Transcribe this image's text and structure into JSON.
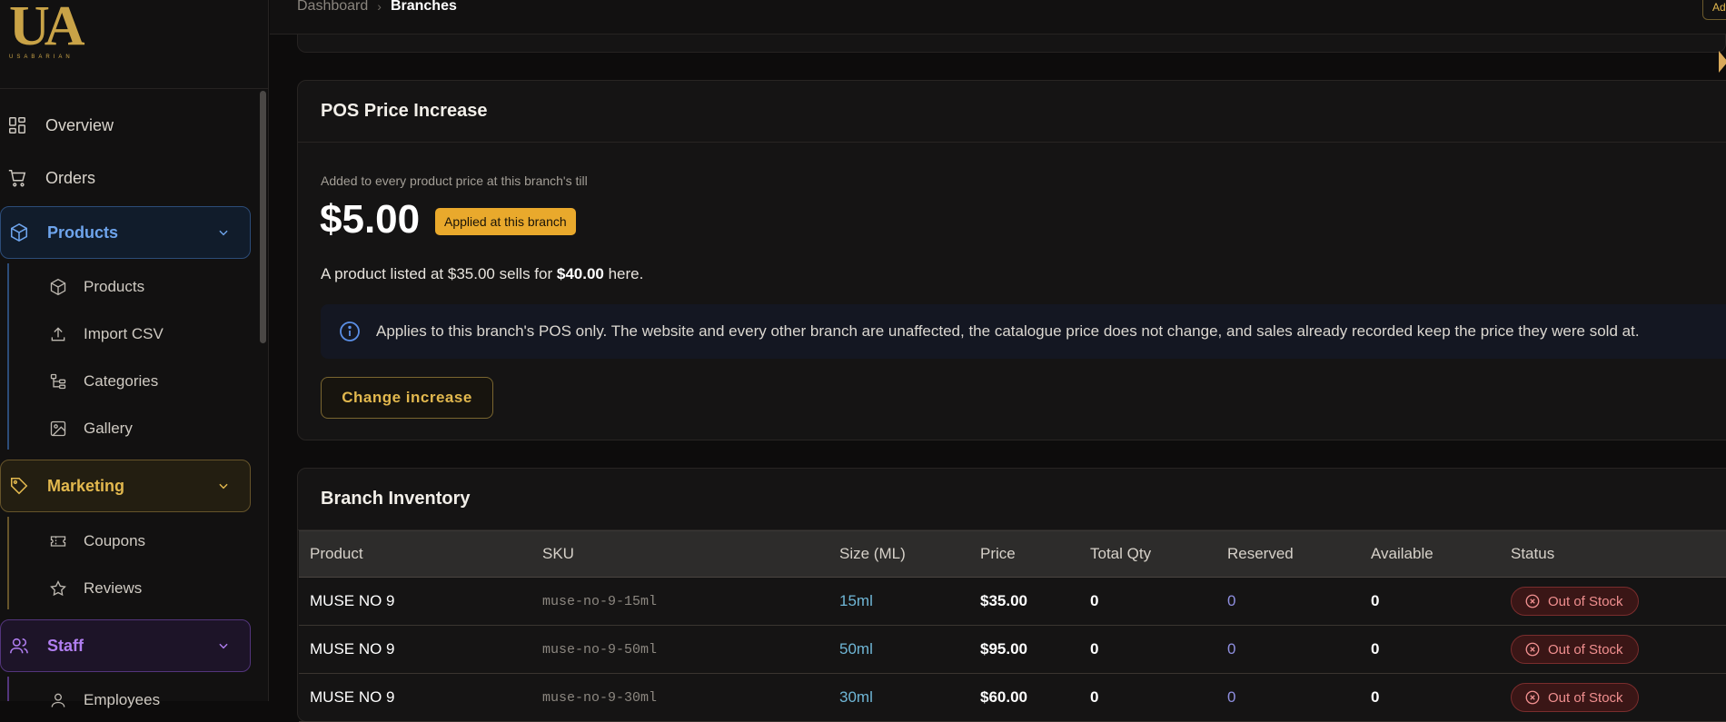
{
  "brand": {
    "mark": "UA",
    "name": "USABARIAN",
    "color": "#c9a347"
  },
  "breadcrumb": {
    "root": "Dashboard",
    "current": "Branches"
  },
  "topbar": {
    "action_label": "Ad"
  },
  "sidebar": {
    "items": [
      {
        "label": "Overview",
        "icon": "grid-icon"
      },
      {
        "label": "Orders",
        "icon": "cart-icon"
      }
    ],
    "groups": {
      "products": {
        "label": "Products",
        "icon": "box-icon",
        "color": "#6ea4ec",
        "children": [
          {
            "label": "Products",
            "icon": "box-icon"
          },
          {
            "label": "Import CSV",
            "icon": "upload-icon"
          },
          {
            "label": "Categories",
            "icon": "tree-icon"
          },
          {
            "label": "Gallery",
            "icon": "image-icon"
          }
        ]
      },
      "marketing": {
        "label": "Marketing",
        "icon": "tag-icon",
        "color": "#e2b84e",
        "children": [
          {
            "label": "Coupons",
            "icon": "ticket-icon"
          },
          {
            "label": "Reviews",
            "icon": "star-icon"
          }
        ]
      },
      "staff": {
        "label": "Staff",
        "icon": "users-icon",
        "color": "#b07ef0",
        "children": [
          {
            "label": "Employees",
            "icon": "user-icon"
          }
        ]
      }
    }
  },
  "pos": {
    "title": "POS Price Increase",
    "subtitle": "Added to every product price at this branch's till",
    "amount": "$5.00",
    "badge": "Applied at this branch",
    "note_prefix": "A product listed at $35.00 sells for ",
    "note_price": "$40.00",
    "note_suffix": " here.",
    "info": "Applies to this branch's POS only. The website and every other branch are unaffected, the catalogue price does not change, and sales already recorded keep the price they were sold at.",
    "change_button": "Change increase"
  },
  "inventory": {
    "title": "Branch Inventory",
    "columns": [
      "Product",
      "SKU",
      "Size (ML)",
      "Price",
      "Total Qty",
      "Reserved",
      "Available",
      "Status"
    ],
    "rows": [
      {
        "product": "MUSE NO 9",
        "sku": "muse-no-9-15ml",
        "size": "15ml",
        "price": "$35.00",
        "total": "0",
        "reserved": "0",
        "available": "0",
        "status": "Out of Stock"
      },
      {
        "product": "MUSE NO 9",
        "sku": "muse-no-9-50ml",
        "size": "50ml",
        "price": "$95.00",
        "total": "0",
        "reserved": "0",
        "available": "0",
        "status": "Out of Stock"
      },
      {
        "product": "MUSE NO 9",
        "sku": "muse-no-9-30ml",
        "size": "30ml",
        "price": "$60.00",
        "total": "0",
        "reserved": "0",
        "available": "0",
        "status": "Out of Stock"
      }
    ]
  }
}
